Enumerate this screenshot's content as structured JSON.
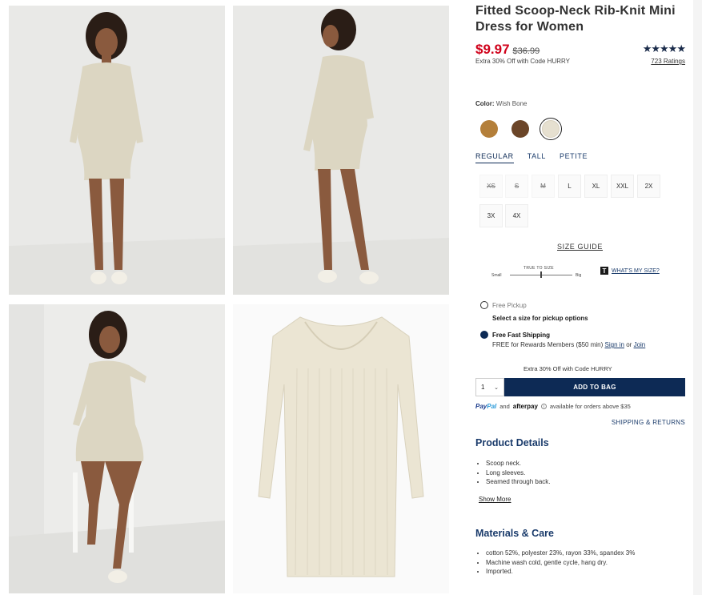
{
  "gallery": {
    "photos": [
      {
        "alt": "model-front"
      },
      {
        "alt": "model-back"
      },
      {
        "alt": "model-seated"
      },
      {
        "alt": "dress-flat"
      }
    ]
  },
  "product": {
    "title": "Fitted Scoop-Neck Rib-Knit Mini Dress for Women",
    "price_now": "$9.97",
    "price_was": "$36.99",
    "promo": "Extra 30% Off with Code HURRY",
    "stars": "★★★★★",
    "rating_value": 4.5,
    "ratings_link": "723 Ratings"
  },
  "color": {
    "label": "Color:",
    "value": "Wish Bone",
    "swatches": [
      {
        "name": "tan",
        "hex": "#b47f3a"
      },
      {
        "name": "brown",
        "hex": "#6b4528"
      },
      {
        "name": "wish-bone",
        "hex": "#e6e0d0",
        "selected": true
      }
    ]
  },
  "fits": [
    "REGULAR",
    "TALL",
    "PETITE"
  ],
  "sizes": [
    {
      "label": "XS",
      "available": false
    },
    {
      "label": "S",
      "available": false
    },
    {
      "label": "M",
      "available": false
    },
    {
      "label": "L",
      "available": true
    },
    {
      "label": "XL",
      "available": true
    },
    {
      "label": "XXL",
      "available": true
    },
    {
      "label": "2X",
      "available": true
    },
    {
      "label": "3X",
      "available": true
    },
    {
      "label": "4X",
      "available": true
    }
  ],
  "size_guide": "SIZE GUIDE",
  "true_size": {
    "label": "TRUE TO SIZE",
    "small": "Small",
    "big": "Big",
    "icon_letter": "T",
    "whats_my_size": "WHAT'S MY SIZE?"
  },
  "fulfillment": {
    "pickup_label": "Free Pickup",
    "pickup_sub": "Select a size for pickup options",
    "ship_label": "Free Fast Shipping",
    "ship_sub": "FREE for Rewards Members ($50 min)",
    "sign_in": "Sign in",
    "or": "or",
    "join": "Join"
  },
  "bag": {
    "promo": "Extra 30% Off with Code HURRY",
    "qty": "1",
    "add_label": "ADD TO BAG"
  },
  "payments": {
    "paypal_a": "Pay",
    "paypal_b": "Pal",
    "and": "and",
    "afterpay": "afterpay",
    "note": "available for orders above $35"
  },
  "shipping_returns": "SHIPPING & RETURNS",
  "details": {
    "title": "Product Details",
    "items": [
      "Scoop neck.",
      "Long sleeves.",
      "Seamed through back."
    ],
    "show_more": "Show More"
  },
  "materials": {
    "title": "Materials & Care",
    "items": [
      "cotton 52%, polyester 23%, rayon 33%, spandex 3%",
      "Machine wash cold, gentle cycle, hang dry.",
      "Imported."
    ]
  }
}
